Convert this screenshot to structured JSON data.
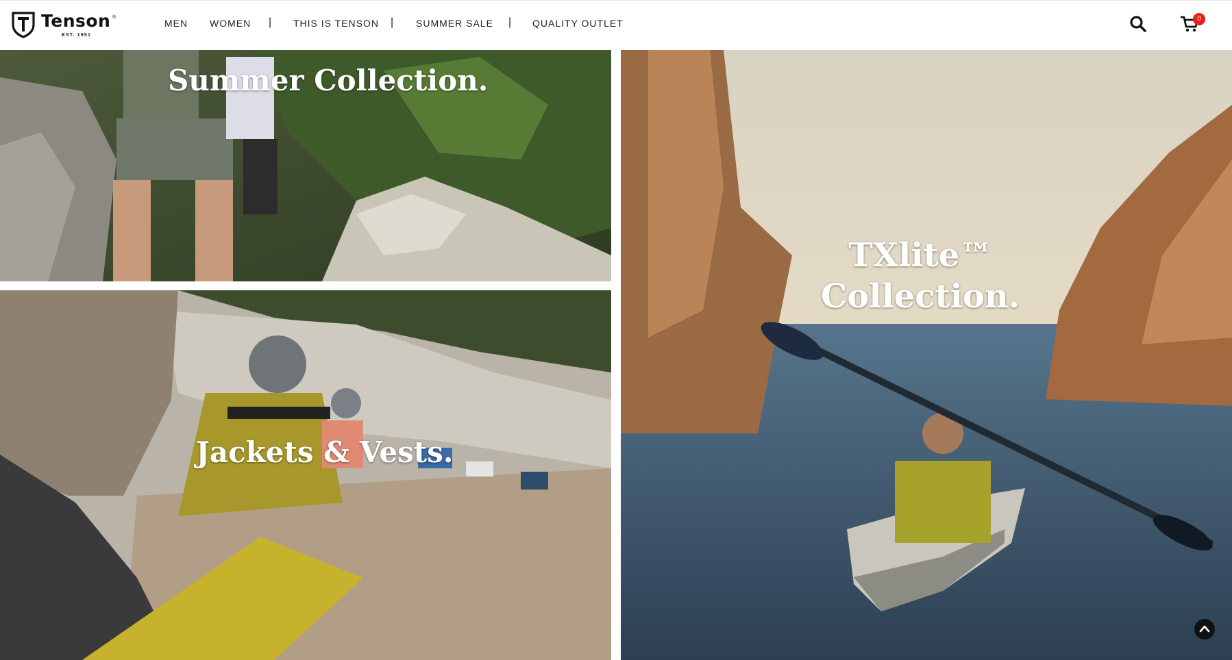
{
  "brand": {
    "name": "Tenson",
    "est": "EST. 1951",
    "registered": "®"
  },
  "nav": {
    "men": "MEN",
    "women": "WOMEN",
    "this_is": "THIS IS TENSON",
    "summer_sale": "SUMMER SALE",
    "outlet": "QUALITY OUTLET",
    "separator": "|"
  },
  "header": {
    "search_icon": "search-icon",
    "cart_icon": "cart-icon",
    "cart_count": "0"
  },
  "tiles": {
    "summer": {
      "title": "Summer Collection."
    },
    "jackets": {
      "title": "Jackets & Vests."
    },
    "txlite": {
      "line1": "TXlite™",
      "line2": "Collection."
    }
  },
  "colors": {
    "accent": "#e8201c",
    "text": "#111111"
  }
}
